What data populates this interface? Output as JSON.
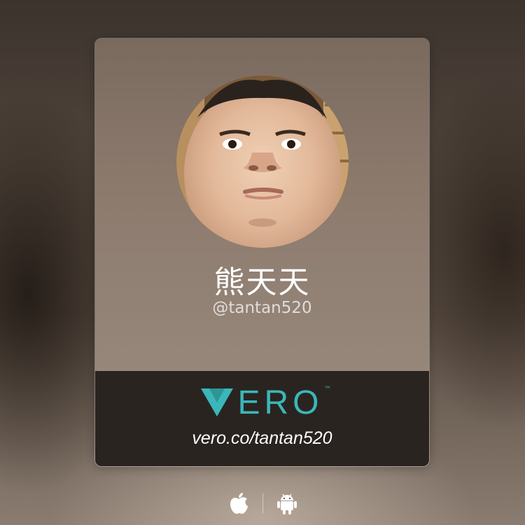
{
  "profile": {
    "display_name": "熊天天",
    "handle": "@tantan520"
  },
  "brand": {
    "wordmark_rest": "ERO",
    "trademark": "™",
    "profile_url": "vero.co/tantan520",
    "accent_color": "#3ab7b9"
  },
  "platforms": {
    "icons": [
      "apple-icon",
      "android-icon"
    ]
  }
}
